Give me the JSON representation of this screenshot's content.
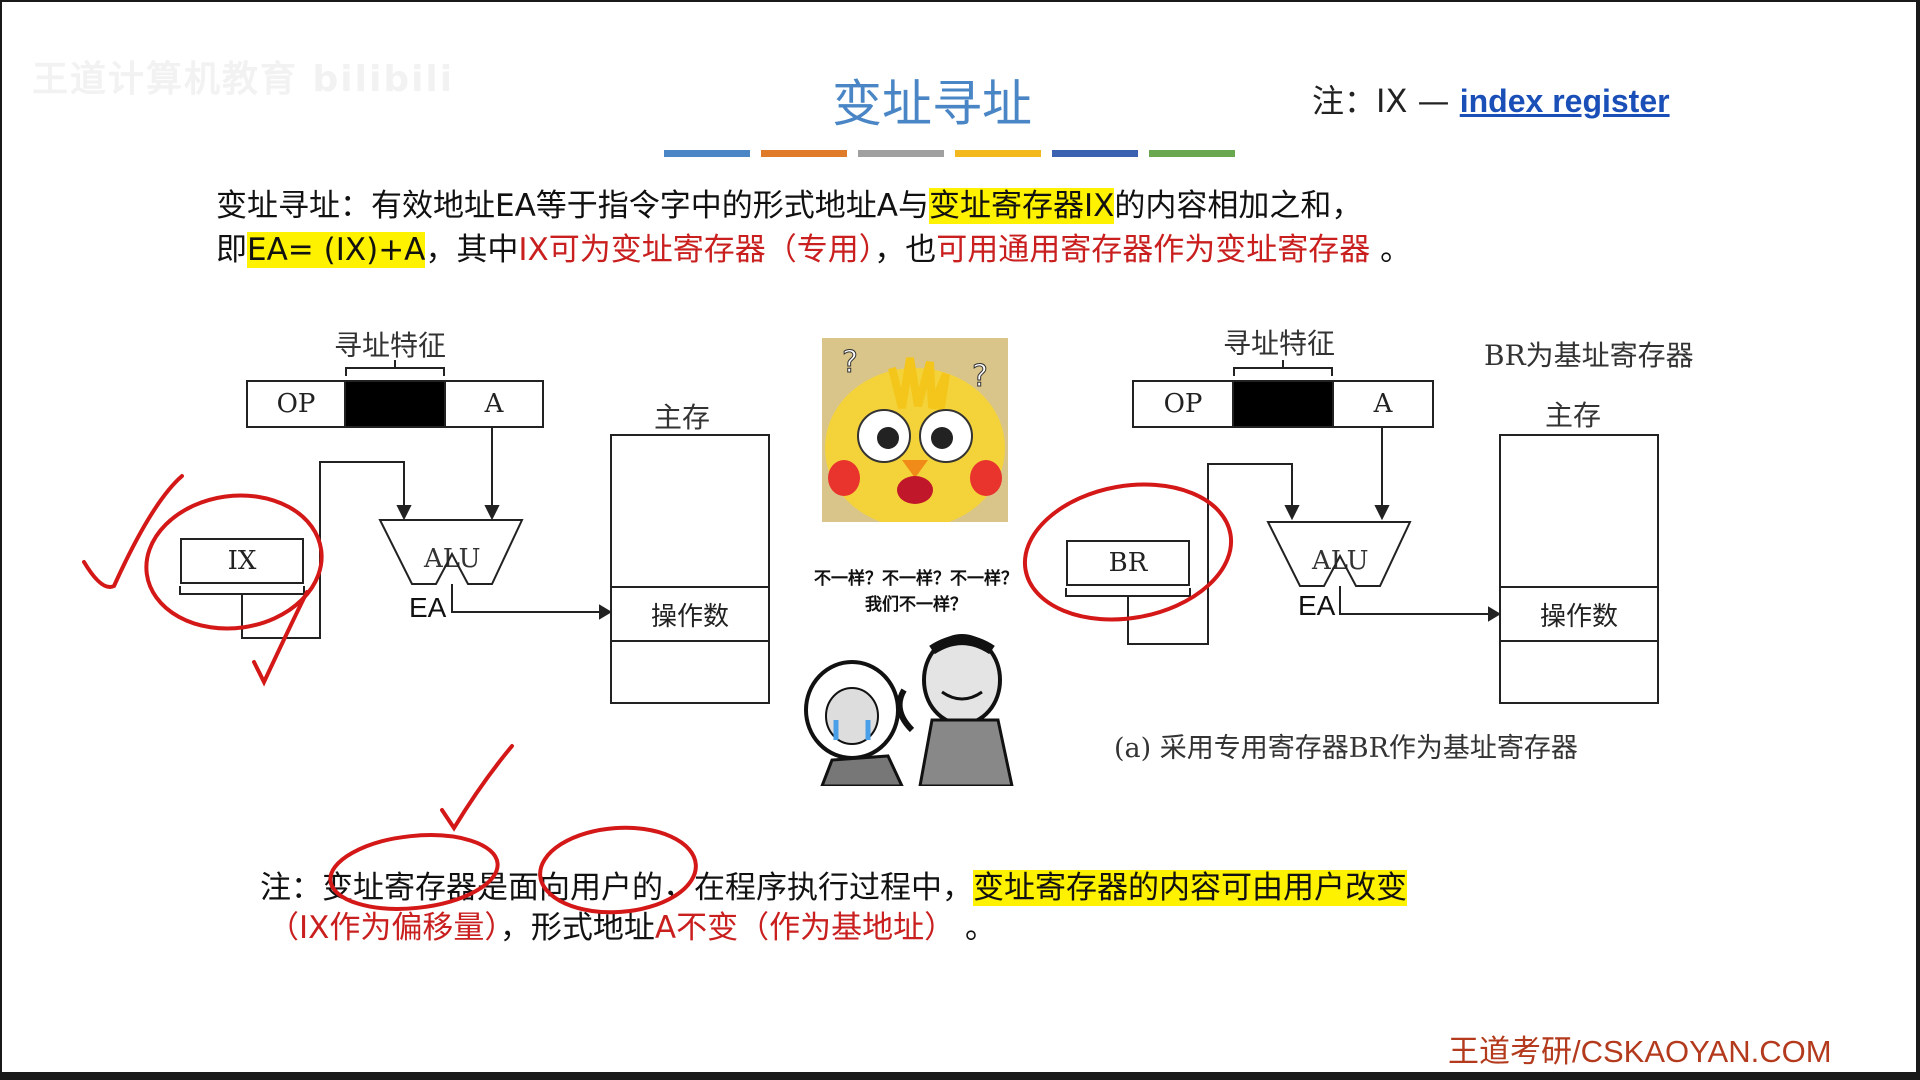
{
  "watermark": "王道计算机教育 bilibili",
  "title": "变址寻址",
  "note_top": {
    "prefix": "注：IX — ",
    "link": "index register"
  },
  "colors": {
    "bar": [
      "#4a86c5",
      "#e07b2a",
      "#a0a0a0",
      "#f3b81d",
      "#3a62b0",
      "#6aa84f"
    ],
    "title": "#4a86c5",
    "red": "#c91f1f",
    "highlight": "#fff200"
  },
  "def": {
    "l1a": "变址寻址：有效地址EA等于指令字中的形式地址A与",
    "l1b": "变址寄存器IX",
    "l1c": "的内容相加之和，",
    "l2a": "即",
    "l2b": "EA= (IX)+A",
    "l2c": "，其中",
    "l2d": "IX可为变址寄存器（专用）",
    "l2e": "，也",
    "l2f": "可用通用寄存器作为变址寄存器",
    "l2g": " 。"
  },
  "left_diagram": {
    "label": "寻址特征",
    "op": "OP",
    "a": "A",
    "reg": "IX",
    "alu": "ALU",
    "ea": "EA",
    "mem": "主存",
    "operand": "操作数"
  },
  "right_diagram": {
    "label": "寻址特征",
    "note": "BR为基址寄存器",
    "op": "OP",
    "a": "A",
    "reg": "BR",
    "alu": "ALU",
    "ea": "EA",
    "mem": "主存",
    "operand": "操作数",
    "caption": "(a) 采用专用寄存器BR作为基址寄存器"
  },
  "meme": {
    "line1": "不一样？不一样？不一样？",
    "line2": "我们不一样？"
  },
  "bottom": {
    "a": "注：变址寄存器是",
    "b": "面向用户",
    "c": "的，在程序执行过程中，",
    "d": "变址寄存器的内容可由用户改变",
    "e": "（IX作为偏移量）",
    "f": "，形式地址",
    "g": "A不变（作为基地址）",
    "h": " 。"
  },
  "footer": "王道考研/CSKAOYAN.COM"
}
